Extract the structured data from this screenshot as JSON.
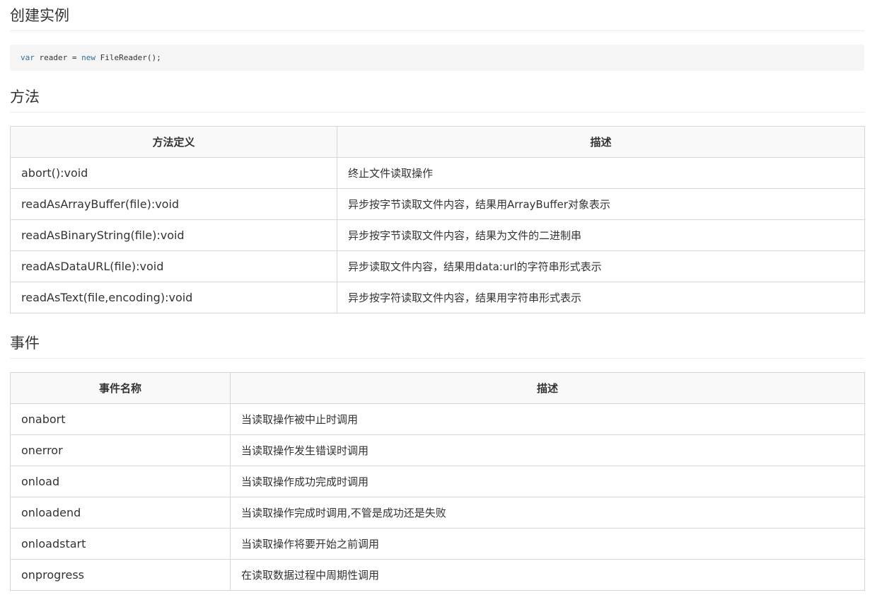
{
  "sections": {
    "create": {
      "title": "创建实例",
      "code": {
        "kw1": "var",
        "mid": " reader = ",
        "kw2": "new",
        "rest": " FileReader();"
      }
    },
    "methods": {
      "title": "方法",
      "headers": [
        "方法定义",
        "描述"
      ],
      "rows": [
        {
          "name": "abort():void",
          "desc": "终止文件读取操作"
        },
        {
          "name": "readAsArrayBuffer(file):void",
          "desc": "异步按字节读取文件内容，结果用ArrayBuffer对象表示"
        },
        {
          "name": "readAsBinaryString(file):void",
          "desc": "异步按字节读取文件内容，结果为文件的二进制串"
        },
        {
          "name": "readAsDataURL(file):void",
          "desc": "异步读取文件内容，结果用data:url的字符串形式表示"
        },
        {
          "name": "readAsText(file,encoding):void",
          "desc": "异步按字符读取文件内容，结果用字符串形式表示"
        }
      ]
    },
    "events": {
      "title": "事件",
      "headers": [
        "事件名称",
        "描述"
      ],
      "rows": [
        {
          "name": "onabort",
          "desc": "当读取操作被中止时调用"
        },
        {
          "name": "onerror",
          "desc": "当读取操作发生错误时调用"
        },
        {
          "name": "onload",
          "desc": "当读取操作成功完成时调用"
        },
        {
          "name": "onloadend",
          "desc": "当读取操作完成时调用,不管是成功还是失败"
        },
        {
          "name": "onloadstart",
          "desc": "当读取操作将要开始之前调用"
        },
        {
          "name": "onprogress",
          "desc": "在读取数据过程中周期性调用"
        }
      ]
    }
  }
}
